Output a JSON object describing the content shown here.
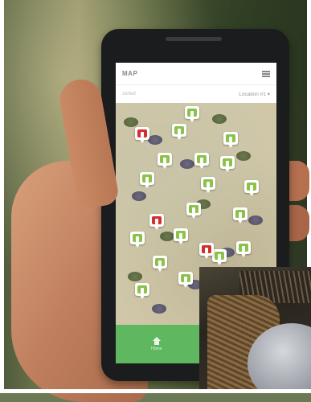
{
  "app": {
    "title": "MAP",
    "filter_left": "sorted",
    "location_select": "Location #1",
    "nav": [
      {
        "label": "Home",
        "icon": "home-icon"
      },
      {
        "label": "",
        "icon": "grid-icon"
      }
    ]
  },
  "colors": {
    "marker_ok": "#8bc34a",
    "marker_alert": "#d32f2f",
    "bottom_bar": "#5fb85f"
  },
  "markers": [
    {
      "status": "ok"
    },
    {
      "status": "ok"
    },
    {
      "status": "alert"
    },
    {
      "status": "ok"
    },
    {
      "status": "ok"
    },
    {
      "status": "ok"
    },
    {
      "status": "ok"
    },
    {
      "status": "ok"
    },
    {
      "status": "ok"
    },
    {
      "status": "ok"
    },
    {
      "status": "ok"
    },
    {
      "status": "alert"
    },
    {
      "status": "ok"
    },
    {
      "status": "ok"
    },
    {
      "status": "ok"
    },
    {
      "status": "ok"
    },
    {
      "status": "ok"
    },
    {
      "status": "alert"
    },
    {
      "status": "ok"
    },
    {
      "status": "ok"
    },
    {
      "status": "ok"
    },
    {
      "status": "ok"
    }
  ]
}
